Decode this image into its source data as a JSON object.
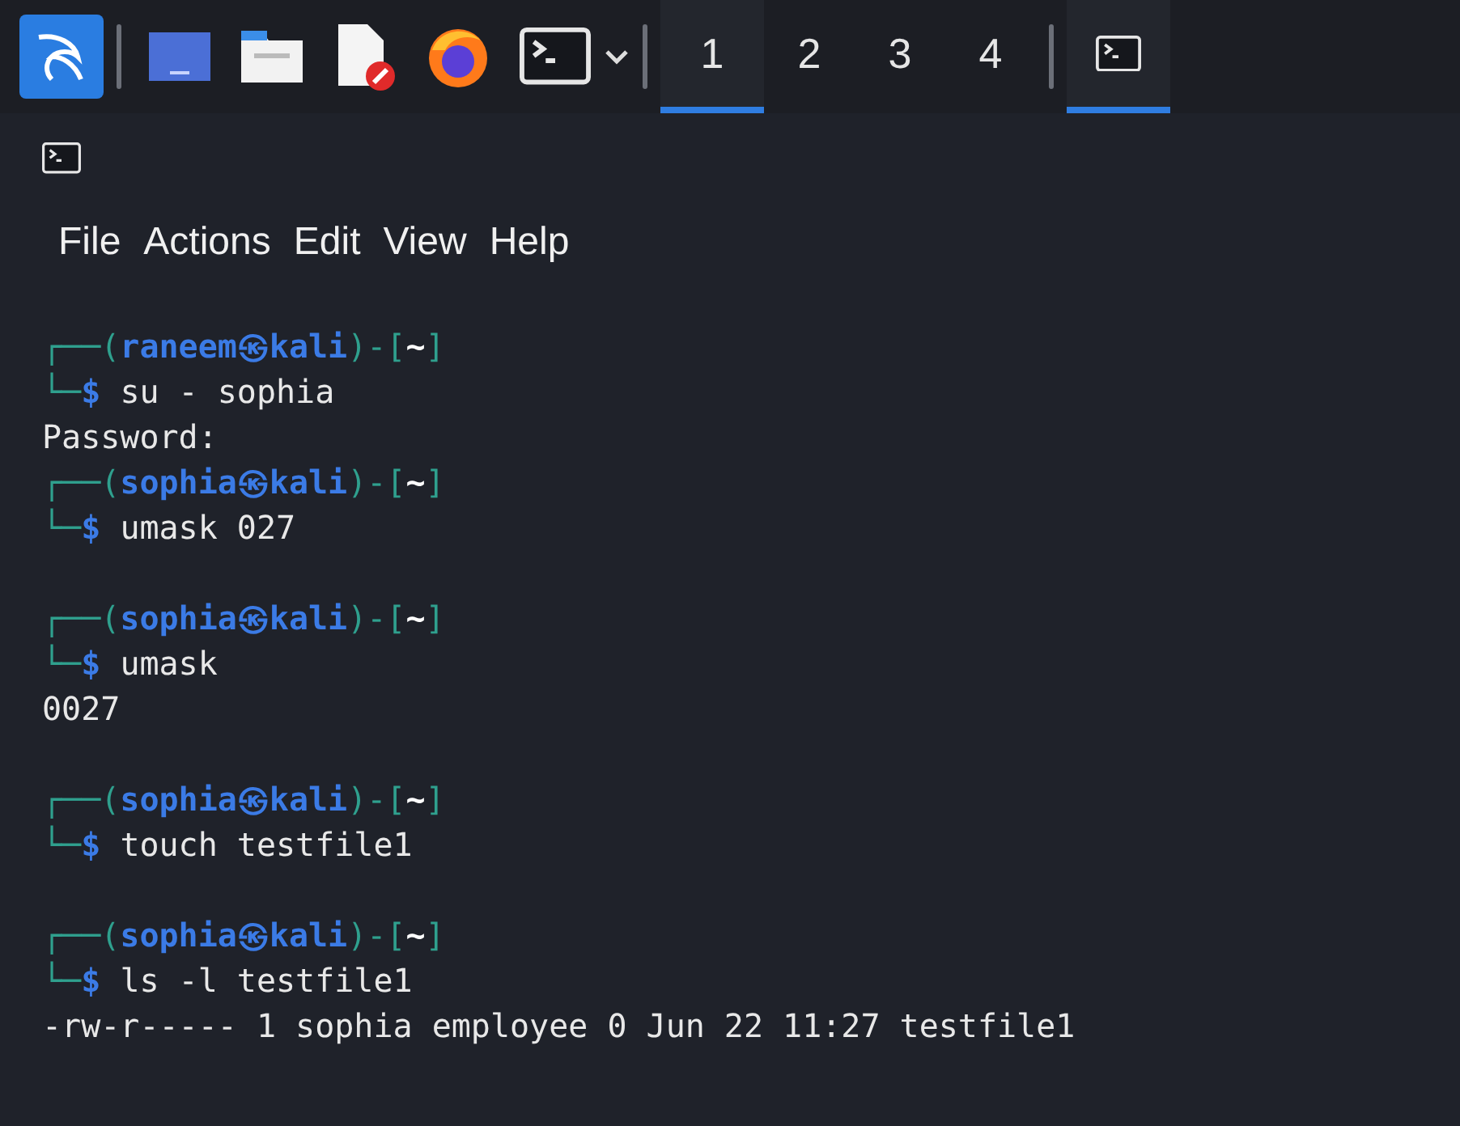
{
  "taskbar": {
    "workspaces": [
      {
        "label": "1",
        "selected": true
      },
      {
        "label": "2",
        "selected": false
      },
      {
        "label": "3",
        "selected": false
      },
      {
        "label": "4",
        "selected": false
      }
    ],
    "task": {
      "selected": true
    }
  },
  "menu": [
    "File",
    "Actions",
    "Edit",
    "View",
    "Help"
  ],
  "terminal": [
    {
      "kind": "prompt",
      "open": "┌──(",
      "userhost": "raneem㉿kali",
      "mid": ")-[",
      "dir": "~",
      "close": "]",
      "corner": "└─",
      "sign": "$",
      "command": "su - sophia"
    },
    {
      "kind": "output",
      "text": "Password:"
    },
    {
      "kind": "prompt",
      "open": "┌──(",
      "userhost": "sophia㉿kali",
      "mid": ")-[",
      "dir": "~",
      "close": "]",
      "corner": "└─",
      "sign": "$",
      "command": "umask 027"
    },
    {
      "kind": "blank"
    },
    {
      "kind": "prompt",
      "open": "┌──(",
      "userhost": "sophia㉿kali",
      "mid": ")-[",
      "dir": "~",
      "close": "]",
      "corner": "└─",
      "sign": "$",
      "command": "umask"
    },
    {
      "kind": "output",
      "text": "0027"
    },
    {
      "kind": "blank"
    },
    {
      "kind": "prompt",
      "open": "┌──(",
      "userhost": "sophia㉿kali",
      "mid": ")-[",
      "dir": "~",
      "close": "]",
      "corner": "└─",
      "sign": "$",
      "command": "touch testfile1"
    },
    {
      "kind": "blank"
    },
    {
      "kind": "prompt",
      "open": "┌──(",
      "userhost": "sophia㉿kali",
      "mid": ")-[",
      "dir": "~",
      "close": "]",
      "corner": "└─",
      "sign": "$",
      "command": "ls -l testfile1"
    },
    {
      "kind": "output",
      "text": "-rw-r----- 1 sophia employee 0 Jun 22 11:27 testfile1"
    }
  ]
}
